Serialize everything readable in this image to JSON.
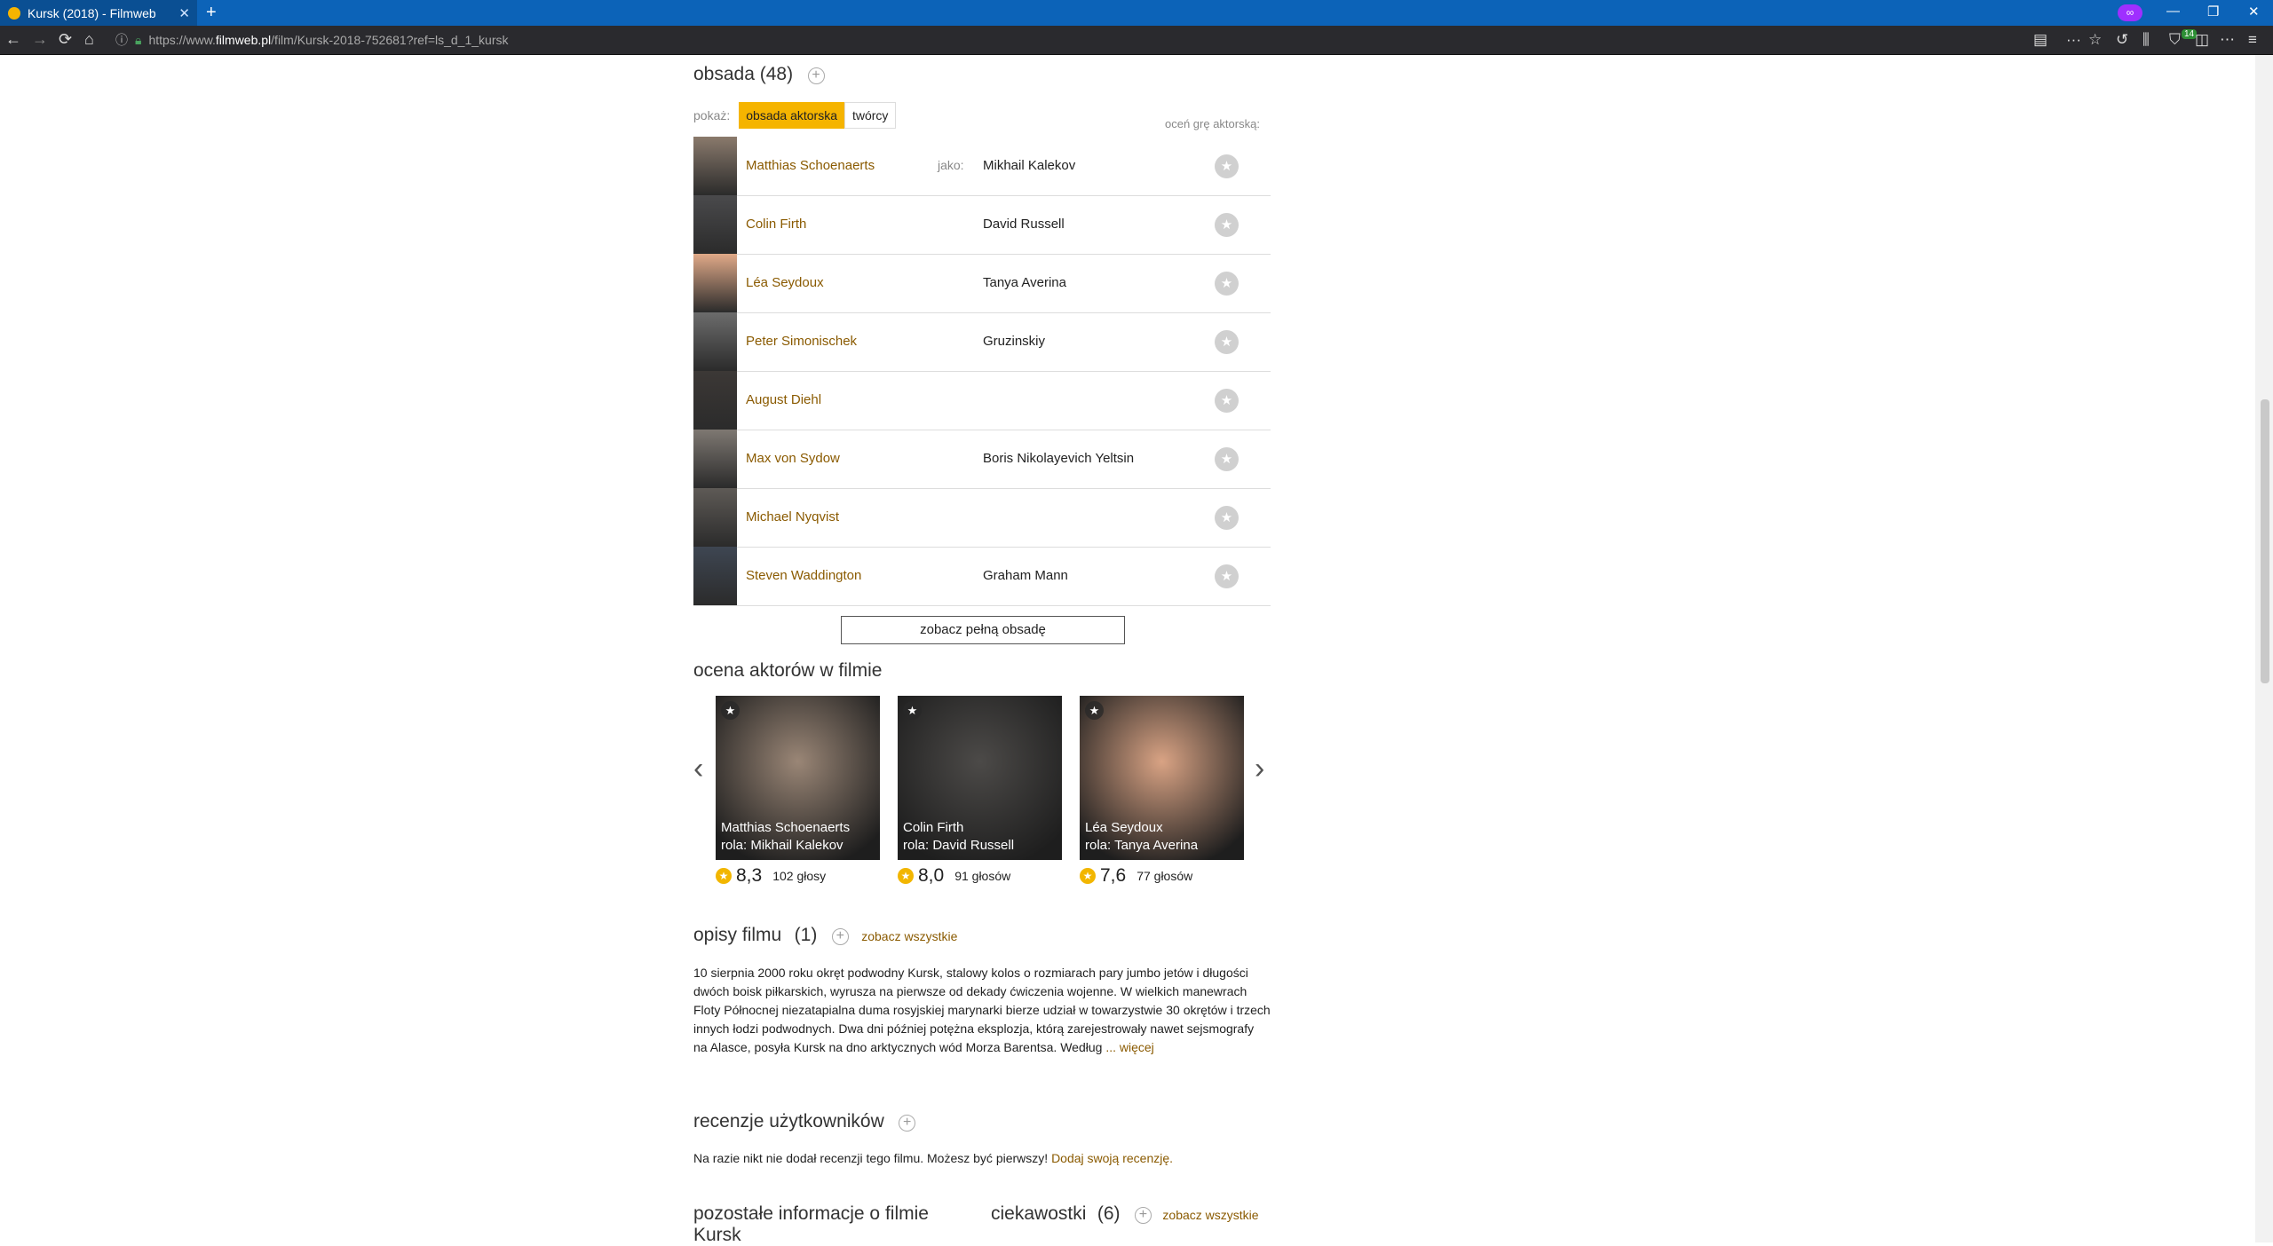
{
  "browser": {
    "tab_title": "Kursk (2018) - Filmweb",
    "tab_close": "✕",
    "new_tab": "+",
    "private_icon": "mask-icon",
    "url_prefix": "https://www.",
    "url_host": "filmweb.pl",
    "url_path": "/film/Kursk-2018-752681?ref=ls_d_1_kursk",
    "badge_count": "14",
    "controls": {
      "minimize": "—",
      "restore": "❐",
      "close": "✕"
    }
  },
  "cast_section": {
    "title": "obsada (48)",
    "show_label": "pokaż:",
    "filter_active": "obsada aktorska",
    "filter_other": "twórcy",
    "rate_hint": "oceń grę aktorską:",
    "jako_label": "jako:",
    "rows": [
      {
        "actor": "Matthias Schoenaerts",
        "role": "Mikhail Kalekov",
        "photo_color": "#8a7a6c"
      },
      {
        "actor": "Colin Firth",
        "role": "David Russell",
        "photo_color": "#4a4a4c"
      },
      {
        "actor": "Léa Seydoux",
        "role": "Tanya Averina",
        "photo_color": "#e0a988"
      },
      {
        "actor": "Peter Simonischek",
        "role": "Gruzinskiy",
        "photo_color": "#6c6c6c"
      },
      {
        "actor": "August Diehl",
        "role": "",
        "photo_color": "#3c3836"
      },
      {
        "actor": "Max von Sydow",
        "role": "Boris Nikolayevich Yeltsin",
        "photo_color": "#7e7872"
      },
      {
        "actor": "Michael Nyqvist",
        "role": "",
        "photo_color": "#5e5a56"
      },
      {
        "actor": "Steven Waddington",
        "role": "Graham Mann",
        "photo_color": "#3e4652"
      }
    ],
    "full_cast_button": "zobacz pełną obsadę"
  },
  "actor_ratings": {
    "title": "ocena aktorów w filmie",
    "cards": [
      {
        "name": "Matthias Schoenaerts",
        "role": "rola: Mikhail Kalekov",
        "score": "8,3",
        "votes": "102 głosy",
        "photo_color": "#9a8676"
      },
      {
        "name": "Colin Firth",
        "role": "rola: David Russell",
        "score": "8,0",
        "votes": "91 głosów",
        "photo_color": "#4c4a48"
      },
      {
        "name": "Léa Seydoux",
        "role": "rola: Tanya Averina",
        "score": "7,6",
        "votes": "77 głosów",
        "photo_color": "#d9a384"
      }
    ]
  },
  "descriptions": {
    "title": "opisy filmu",
    "count": "(1)",
    "see_all": "zobacz wszystkie",
    "text": "10 sierpnia 2000 roku okręt podwodny Kursk, stalowy kolos o rozmiarach pary jumbo jetów i długości dwóch boisk piłkarskich, wyrusza na pierwsze od dekady ćwiczenia wojenne. W wielkich manewrach Floty Północnej niezatapialna duma rosyjskiej marynarki bierze udział w towarzystwie 30 okrętów i trzech innych łodzi podwodnych. Dwa dni później potężna eksplozja, którą zarejestrowały nawet sejsmografy na Alasce, posyła Kursk na dno arktycznych wód Morza Barentsa. Według",
    "more": "... więcej"
  },
  "reviews": {
    "title": "recenzje użytkowników",
    "text": "Na razie nikt nie dodał recenzji tego filmu. Możesz być pierwszy!",
    "link": "Dodaj swoją recenzję."
  },
  "other_info": {
    "title": "pozostałe informacje o filmie",
    "title_cont": "Kursk",
    "trivia_title": "ciekawostki",
    "trivia_count": "(6)",
    "trivia_link": "zobacz wszystkie"
  }
}
